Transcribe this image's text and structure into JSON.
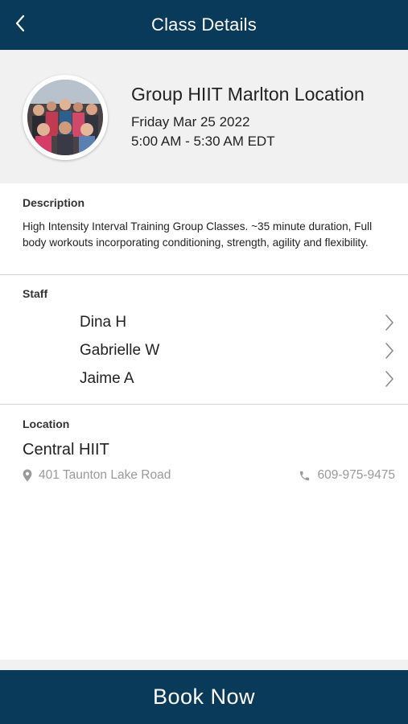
{
  "header": {
    "title": "Class Details",
    "back_icon": "chevron-left-icon"
  },
  "class": {
    "name": "Group HIIT Marlton Location",
    "date": "Friday Mar 25 2022",
    "time": "5:00 AM - 5:30 AM EDT"
  },
  "description": {
    "label": "Description",
    "text": "High Intensity Interval Training Group Classes. ~35 minute duration, Full body workouts incorporating conditioning, strength, agility and flexibility."
  },
  "staff": {
    "label": "Staff",
    "members": [
      {
        "name": "Dina H"
      },
      {
        "name": "Gabrielle W"
      },
      {
        "name": "Jaime A"
      }
    ]
  },
  "location": {
    "label": "Location",
    "name": "Central HIIT",
    "address": "401 Taunton Lake Road",
    "phone": "609-975-9475",
    "address_icon": "map-pin-icon",
    "phone_icon": "phone-icon"
  },
  "actions": {
    "book_label": "Book Now"
  },
  "colors": {
    "primary": "#0a3a5a",
    "hero_bg": "#f1f1f1",
    "muted_text": "#9a9a9a"
  }
}
